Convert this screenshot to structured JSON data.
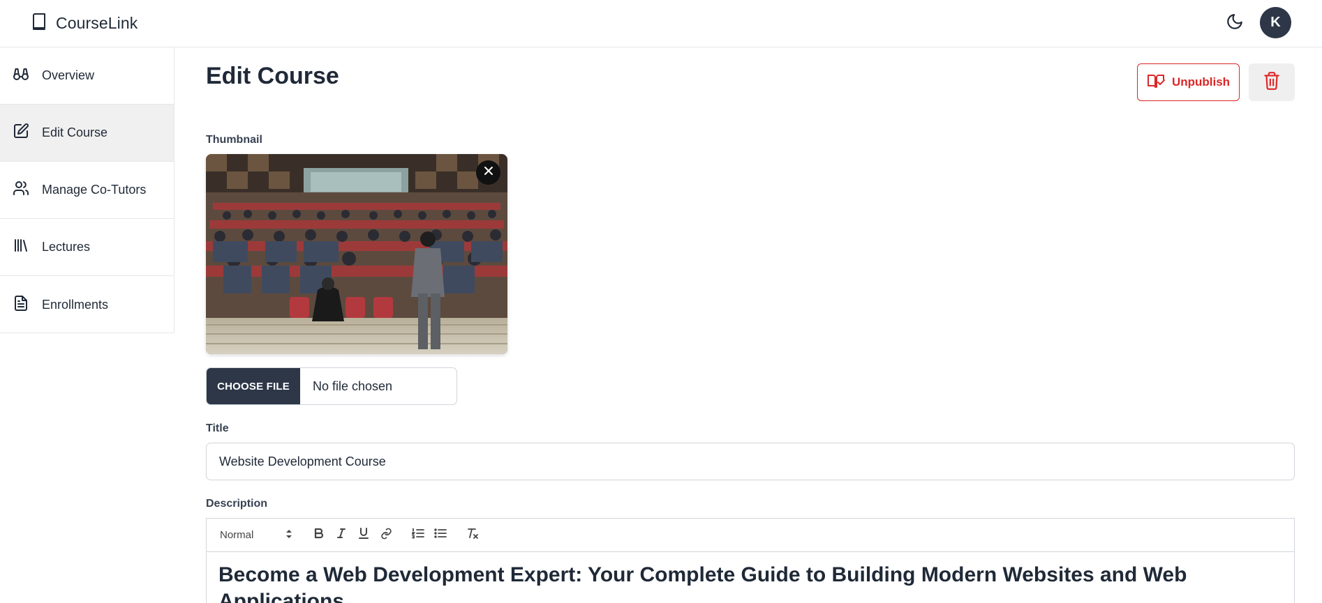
{
  "app": {
    "name": "CourseLink"
  },
  "header": {
    "avatar_initial": "K",
    "theme_icon": "moon-icon"
  },
  "sidebar": {
    "items": [
      {
        "label": "Overview",
        "icon": "binoculars-icon"
      },
      {
        "label": "Edit Course",
        "icon": "edit-icon",
        "active": true
      },
      {
        "label": "Manage Co-Tutors",
        "icon": "users-icon"
      },
      {
        "label": "Lectures",
        "icon": "library-icon"
      },
      {
        "label": "Enrollments",
        "icon": "document-icon"
      }
    ]
  },
  "page": {
    "title": "Edit Course",
    "unpublish_label": "Unpublish"
  },
  "form": {
    "thumbnail_label": "Thumbnail",
    "file_button_label": "CHOOSE FILE",
    "file_status": "No file chosen",
    "title_label": "Title",
    "title_value": "Website Development Course",
    "description_label": "Description",
    "description_format": "Normal",
    "description_heading": "Become a Web Development Expert: Your Complete Guide to Building Modern Websites and Web Applications"
  },
  "colors": {
    "accent_dark": "#2d3748",
    "danger": "#dc2626",
    "active_bg": "#f0f0f0"
  }
}
